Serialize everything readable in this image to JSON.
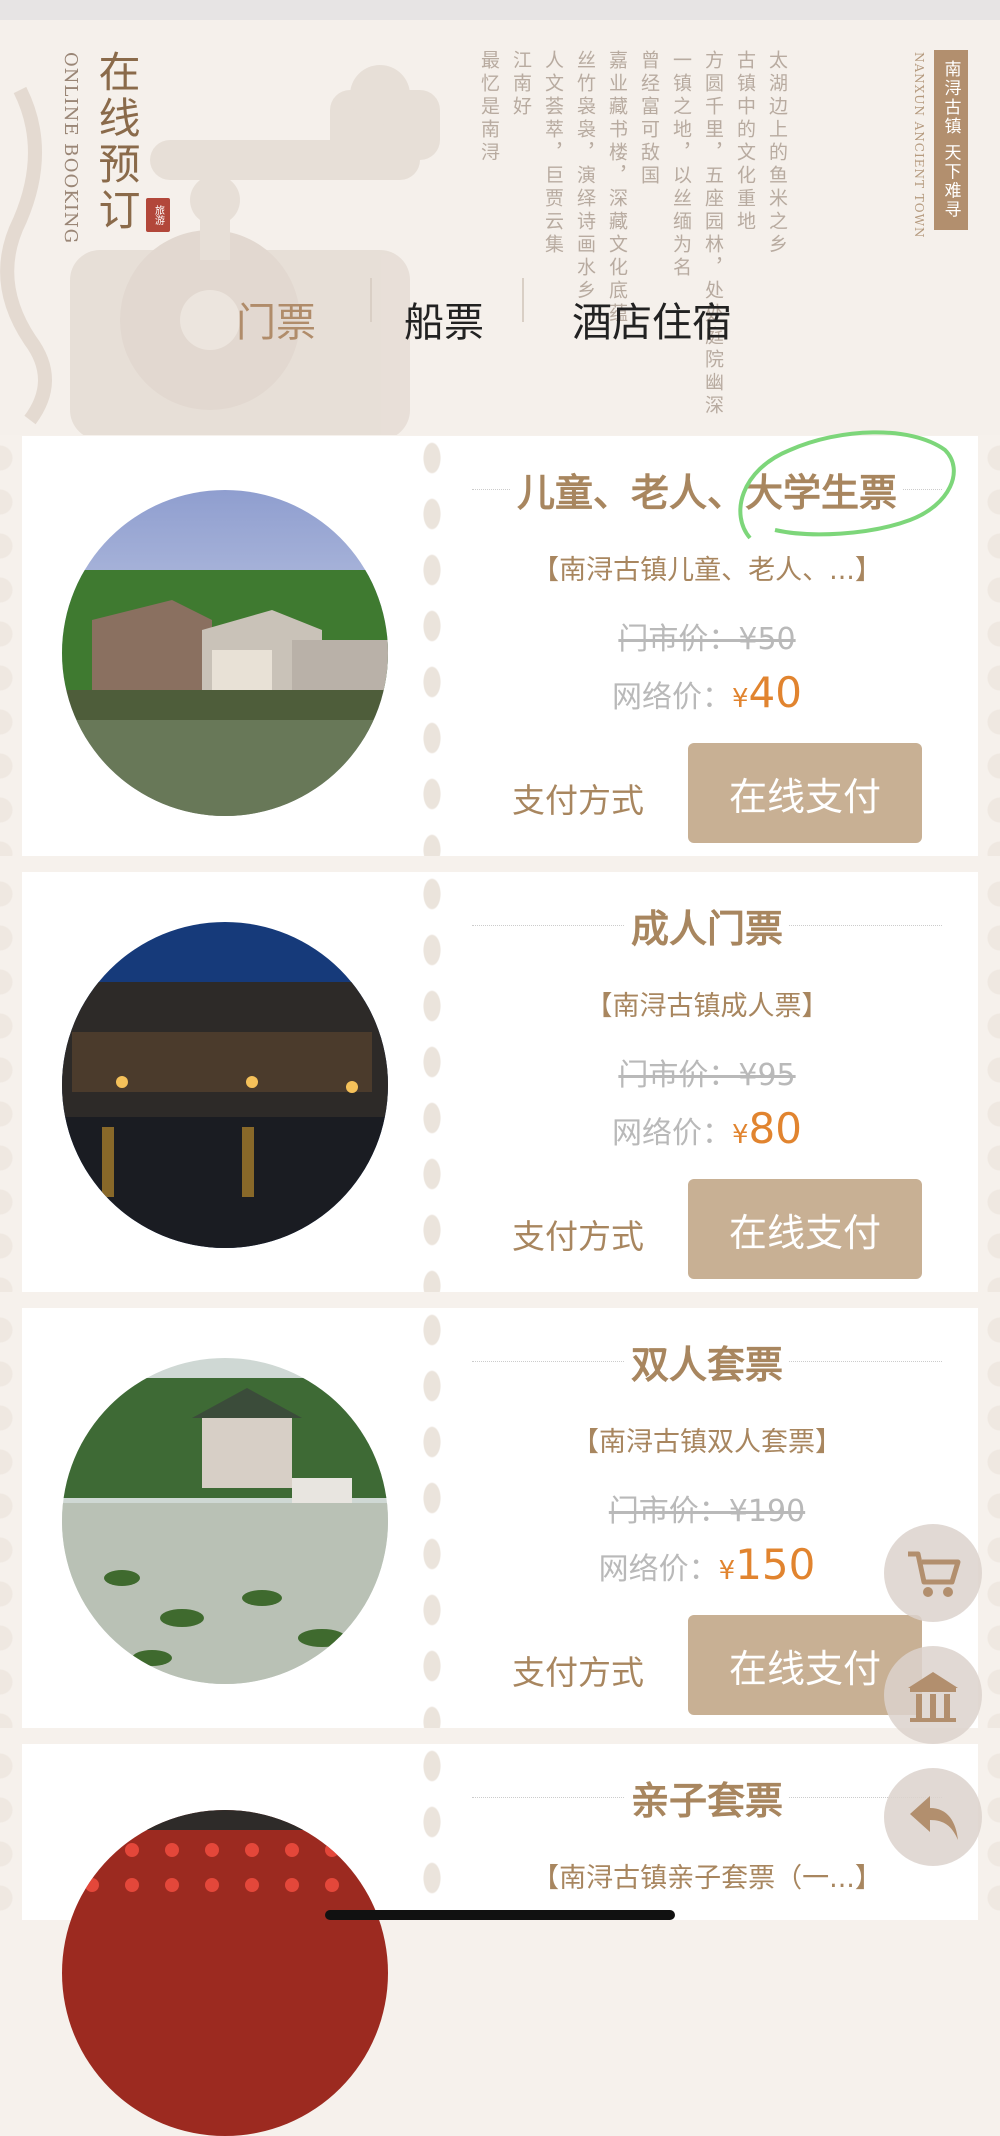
{
  "header": {
    "brand_title": "在线预订",
    "brand_subtitle": "ONLINE BOOKING",
    "brand_seal": "旅游",
    "side_tag": "南浔古镇 天下难寻",
    "side_english": "NANXUN ANCIENT TOWN",
    "poem_lines": [
      "太湖边上的鱼米之乡",
      "古镇中的文化重地",
      "方圆千里，五座园林，处处庭院幽深",
      "一镇之地，以丝缅为名",
      "曾经富可敌国",
      "嘉业藏书楼，深藏文化底蕴",
      "丝竹袅袅，演绎诗画水乡",
      "人文荟萃，巨贾云集",
      "江南好",
      "最忆是南浔"
    ]
  },
  "tabs": [
    {
      "label": "门票",
      "active": true
    },
    {
      "label": "船票",
      "active": false
    },
    {
      "label": "酒店住宿",
      "active": false
    }
  ],
  "tickets": [
    {
      "title": "儿童、老人、大学生票",
      "subtitle": "【南浔古镇儿童、老人、...】",
      "original_price": "门市价：¥50",
      "net_label": "网络价：",
      "currency": "¥",
      "net_price": "40",
      "pay_label": "支付方式",
      "pay_button": "在线支付",
      "photo": "water-town-daytime"
    },
    {
      "title": "成人门票",
      "subtitle": "【南浔古镇成人票】",
      "original_price": "门市价：¥95",
      "net_label": "网络价：",
      "currency": "¥",
      "net_price": "80",
      "pay_label": "支付方式",
      "pay_button": "在线支付",
      "photo": "water-town-night"
    },
    {
      "title": "双人套票",
      "subtitle": "【南浔古镇双人套票】",
      "original_price": "门市价：¥190",
      "net_label": "网络价：",
      "currency": "¥",
      "net_price": "150",
      "pay_label": "支付方式",
      "pay_button": "在线支付",
      "photo": "lotus-pond-villa"
    },
    {
      "title": "亲子套票",
      "subtitle": "【南浔古镇亲子套票（一...】",
      "photo": "red-lanterns"
    }
  ],
  "floating_buttons": [
    "cart-icon",
    "home-icon",
    "back-icon"
  ],
  "colors": {
    "accent_brown": "#a8865f",
    "button_bg": "#c8b094",
    "price_orange": "#e1842f",
    "annotation_green": "#7dd67a"
  }
}
